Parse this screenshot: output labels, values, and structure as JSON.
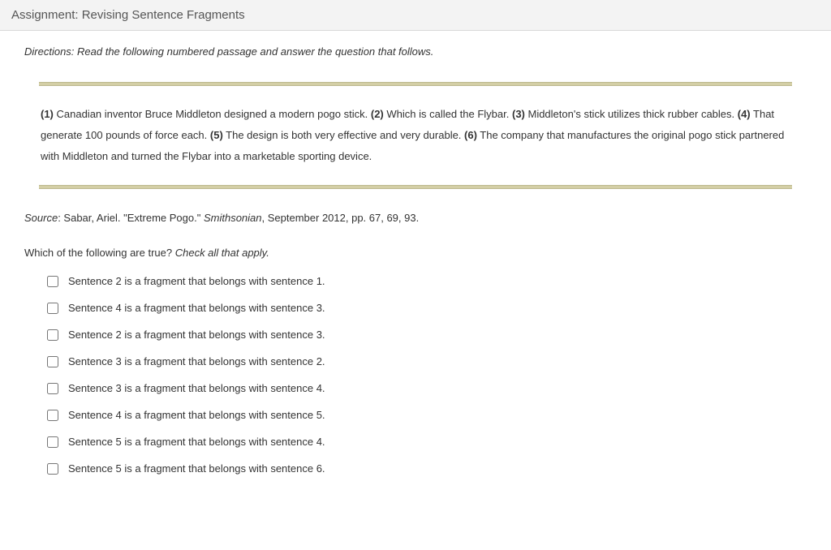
{
  "header": {
    "title": "Assignment: Revising Sentence Fragments"
  },
  "directions": "Directions: Read the following numbered passage and answer the question that follows.",
  "passage": {
    "segments": [
      {
        "num": "(1)",
        "text": " Canadian inventor Bruce Middleton designed a modern pogo stick. "
      },
      {
        "num": "(2)",
        "text": " Which is called the Flybar. "
      },
      {
        "num": "(3)",
        "text": " Middleton's stick utilizes thick rubber cables. "
      },
      {
        "num": "(4)",
        "text": " That generate 100 pounds of force each. "
      },
      {
        "num": "(5)",
        "text": " The design is both very effective and very durable. "
      },
      {
        "num": "(6)",
        "text": " The company that manufactures the original pogo stick partnered with Middleton and turned the Flybar into a marketable sporting device."
      }
    ]
  },
  "source": {
    "label": "Source",
    "text_before": ": Sabar, Ariel. \"Extreme Pogo.\" ",
    "italic": "Smithsonian",
    "text_after": ", September 2012, pp. 67, 69, 93."
  },
  "question": {
    "stem": "Which of the following are true?  ",
    "hint": "Check all that apply."
  },
  "options": [
    "Sentence 2 is a fragment that belongs with sentence 1.",
    "Sentence 4 is a fragment that belongs with sentence 3.",
    "Sentence 2 is a fragment that belongs with sentence 3.",
    "Sentence 3 is a fragment that belongs with sentence 2.",
    "Sentence 3 is a fragment that belongs with sentence 4.",
    "Sentence 4 is a fragment that belongs with sentence 5.",
    "Sentence 5 is a fragment that belongs with sentence 4.",
    "Sentence 5 is a fragment that belongs with sentence 6."
  ]
}
